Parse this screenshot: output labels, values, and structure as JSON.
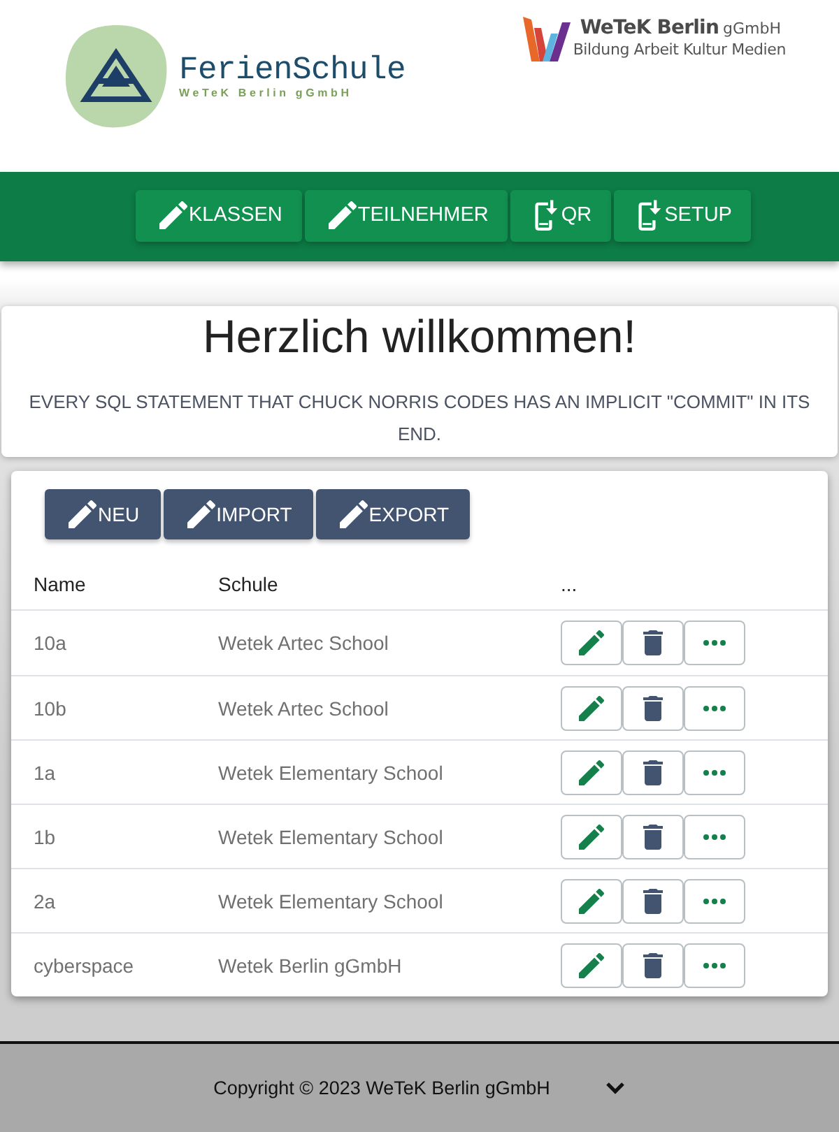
{
  "header": {
    "logo": {
      "title": "FerienSchule",
      "subtitle": "WeTeK Berlin gGmbH"
    },
    "partner_logo": {
      "name": "WeTeK Berlin",
      "suffix": "gGmbH",
      "tagline": "Bildung Arbeit Kultur Medien"
    }
  },
  "nav": [
    {
      "label": "KLASSEN",
      "kind": "edit"
    },
    {
      "label": "TEILNEHMER",
      "kind": "edit"
    },
    {
      "label": "QR",
      "kind": "download"
    },
    {
      "label": "SETUP",
      "kind": "download"
    }
  ],
  "welcome": {
    "title": "Herzlich willkommen!",
    "quote": "EVERY SQL STATEMENT THAT CHUCK NORRIS CODES HAS AN IMPLICIT \"COMMIT\" IN ITS END."
  },
  "toolbar": [
    {
      "label": "NEU"
    },
    {
      "label": "IMPORT"
    },
    {
      "label": "EXPORT"
    }
  ],
  "table": {
    "columns": [
      "Name",
      "Schule",
      "..."
    ],
    "rows": [
      {
        "name": "10a",
        "school": "Wetek Artec School"
      },
      {
        "name": "10b",
        "school": "Wetek Artec School"
      },
      {
        "name": "1a",
        "school": "Wetek Elementary School"
      },
      {
        "name": "1b",
        "school": "Wetek Elementary School"
      },
      {
        "name": "2a",
        "school": "Wetek Elementary School"
      },
      {
        "name": "cyberspace",
        "school": "Wetek Berlin gGmbH"
      }
    ]
  },
  "footer": {
    "copyright": "Copyright © 2023 WeTeK Berlin gGmbH"
  }
}
